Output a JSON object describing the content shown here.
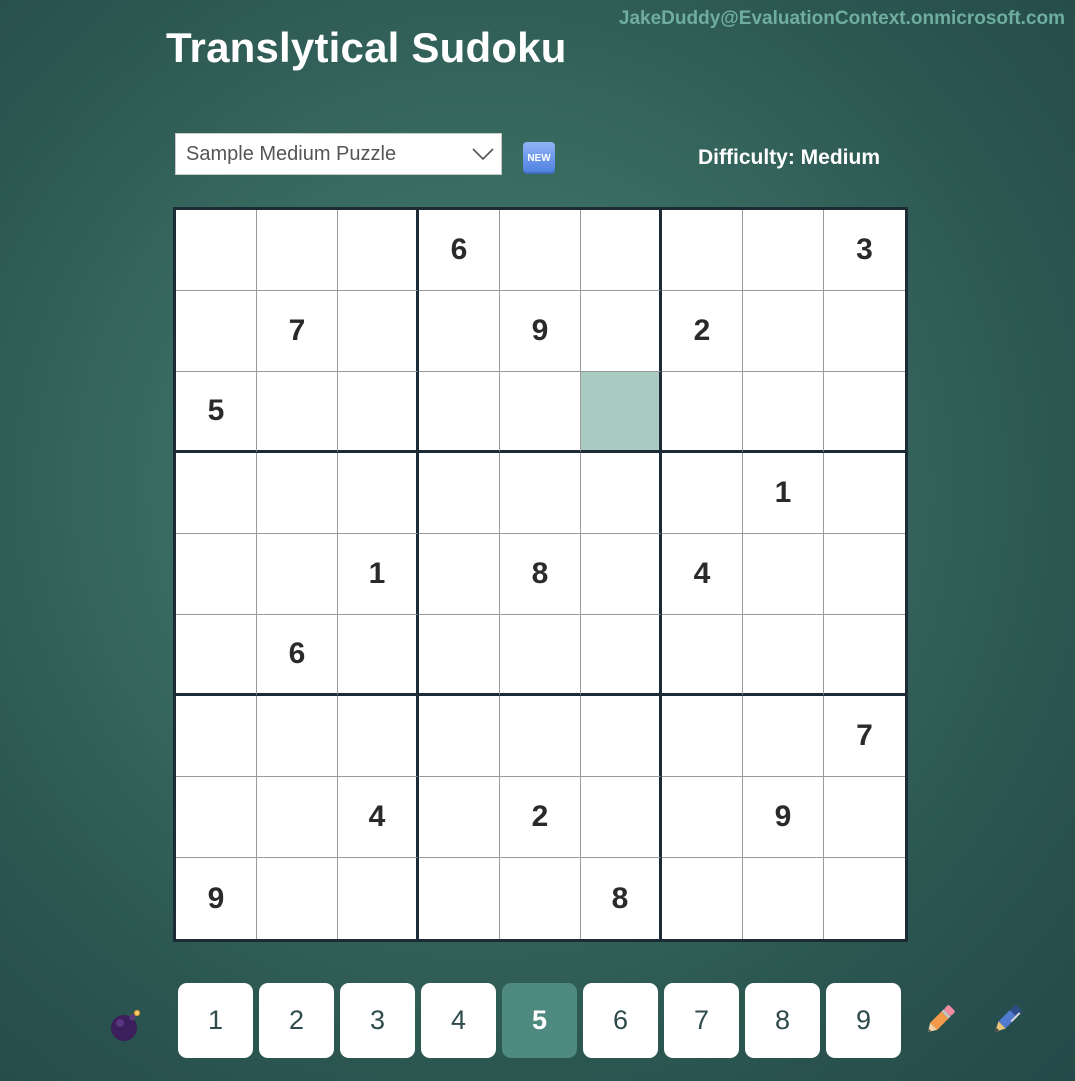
{
  "user": {
    "email": "JakeDuddy@EvaluationContext.onmicrosoft.com"
  },
  "header": {
    "title": "Translytical Sudoku"
  },
  "controls": {
    "puzzle_select": {
      "value": "Sample Medium Puzzle"
    },
    "new_button": {
      "label": "NEW"
    },
    "difficulty_label": "Difficulty: Medium"
  },
  "board": {
    "rows": [
      [
        "",
        "",
        "",
        "6",
        "",
        "",
        "",
        "",
        "3"
      ],
      [
        "",
        "7",
        "",
        "",
        "9",
        "",
        "2",
        "",
        ""
      ],
      [
        "5",
        "",
        "",
        "",
        "",
        "",
        "",
        "",
        ""
      ],
      [
        "",
        "",
        "",
        "",
        "",
        "",
        "",
        "1",
        ""
      ],
      [
        "",
        "",
        "1",
        "",
        "8",
        "",
        "4",
        "",
        ""
      ],
      [
        "",
        "6",
        "",
        "",
        "",
        "",
        "",
        "",
        ""
      ],
      [
        "",
        "",
        "",
        "",
        "",
        "",
        "",
        "",
        "7"
      ],
      [
        "",
        "",
        "4",
        "",
        "2",
        "",
        "",
        "9",
        ""
      ],
      [
        "9",
        "",
        "",
        "",
        "",
        "8",
        "",
        "",
        ""
      ]
    ],
    "selected_cell": {
      "row": 3,
      "col": 6
    },
    "selected_color": "#a9cbc2"
  },
  "numpad": {
    "buttons": [
      "1",
      "2",
      "3",
      "4",
      "5",
      "6",
      "7",
      "8",
      "9"
    ],
    "active": "5",
    "active_color": "#4e8a80"
  },
  "tools": {
    "left": "bomb-icon",
    "right": [
      "pencil-icon",
      "pen-icon"
    ]
  }
}
